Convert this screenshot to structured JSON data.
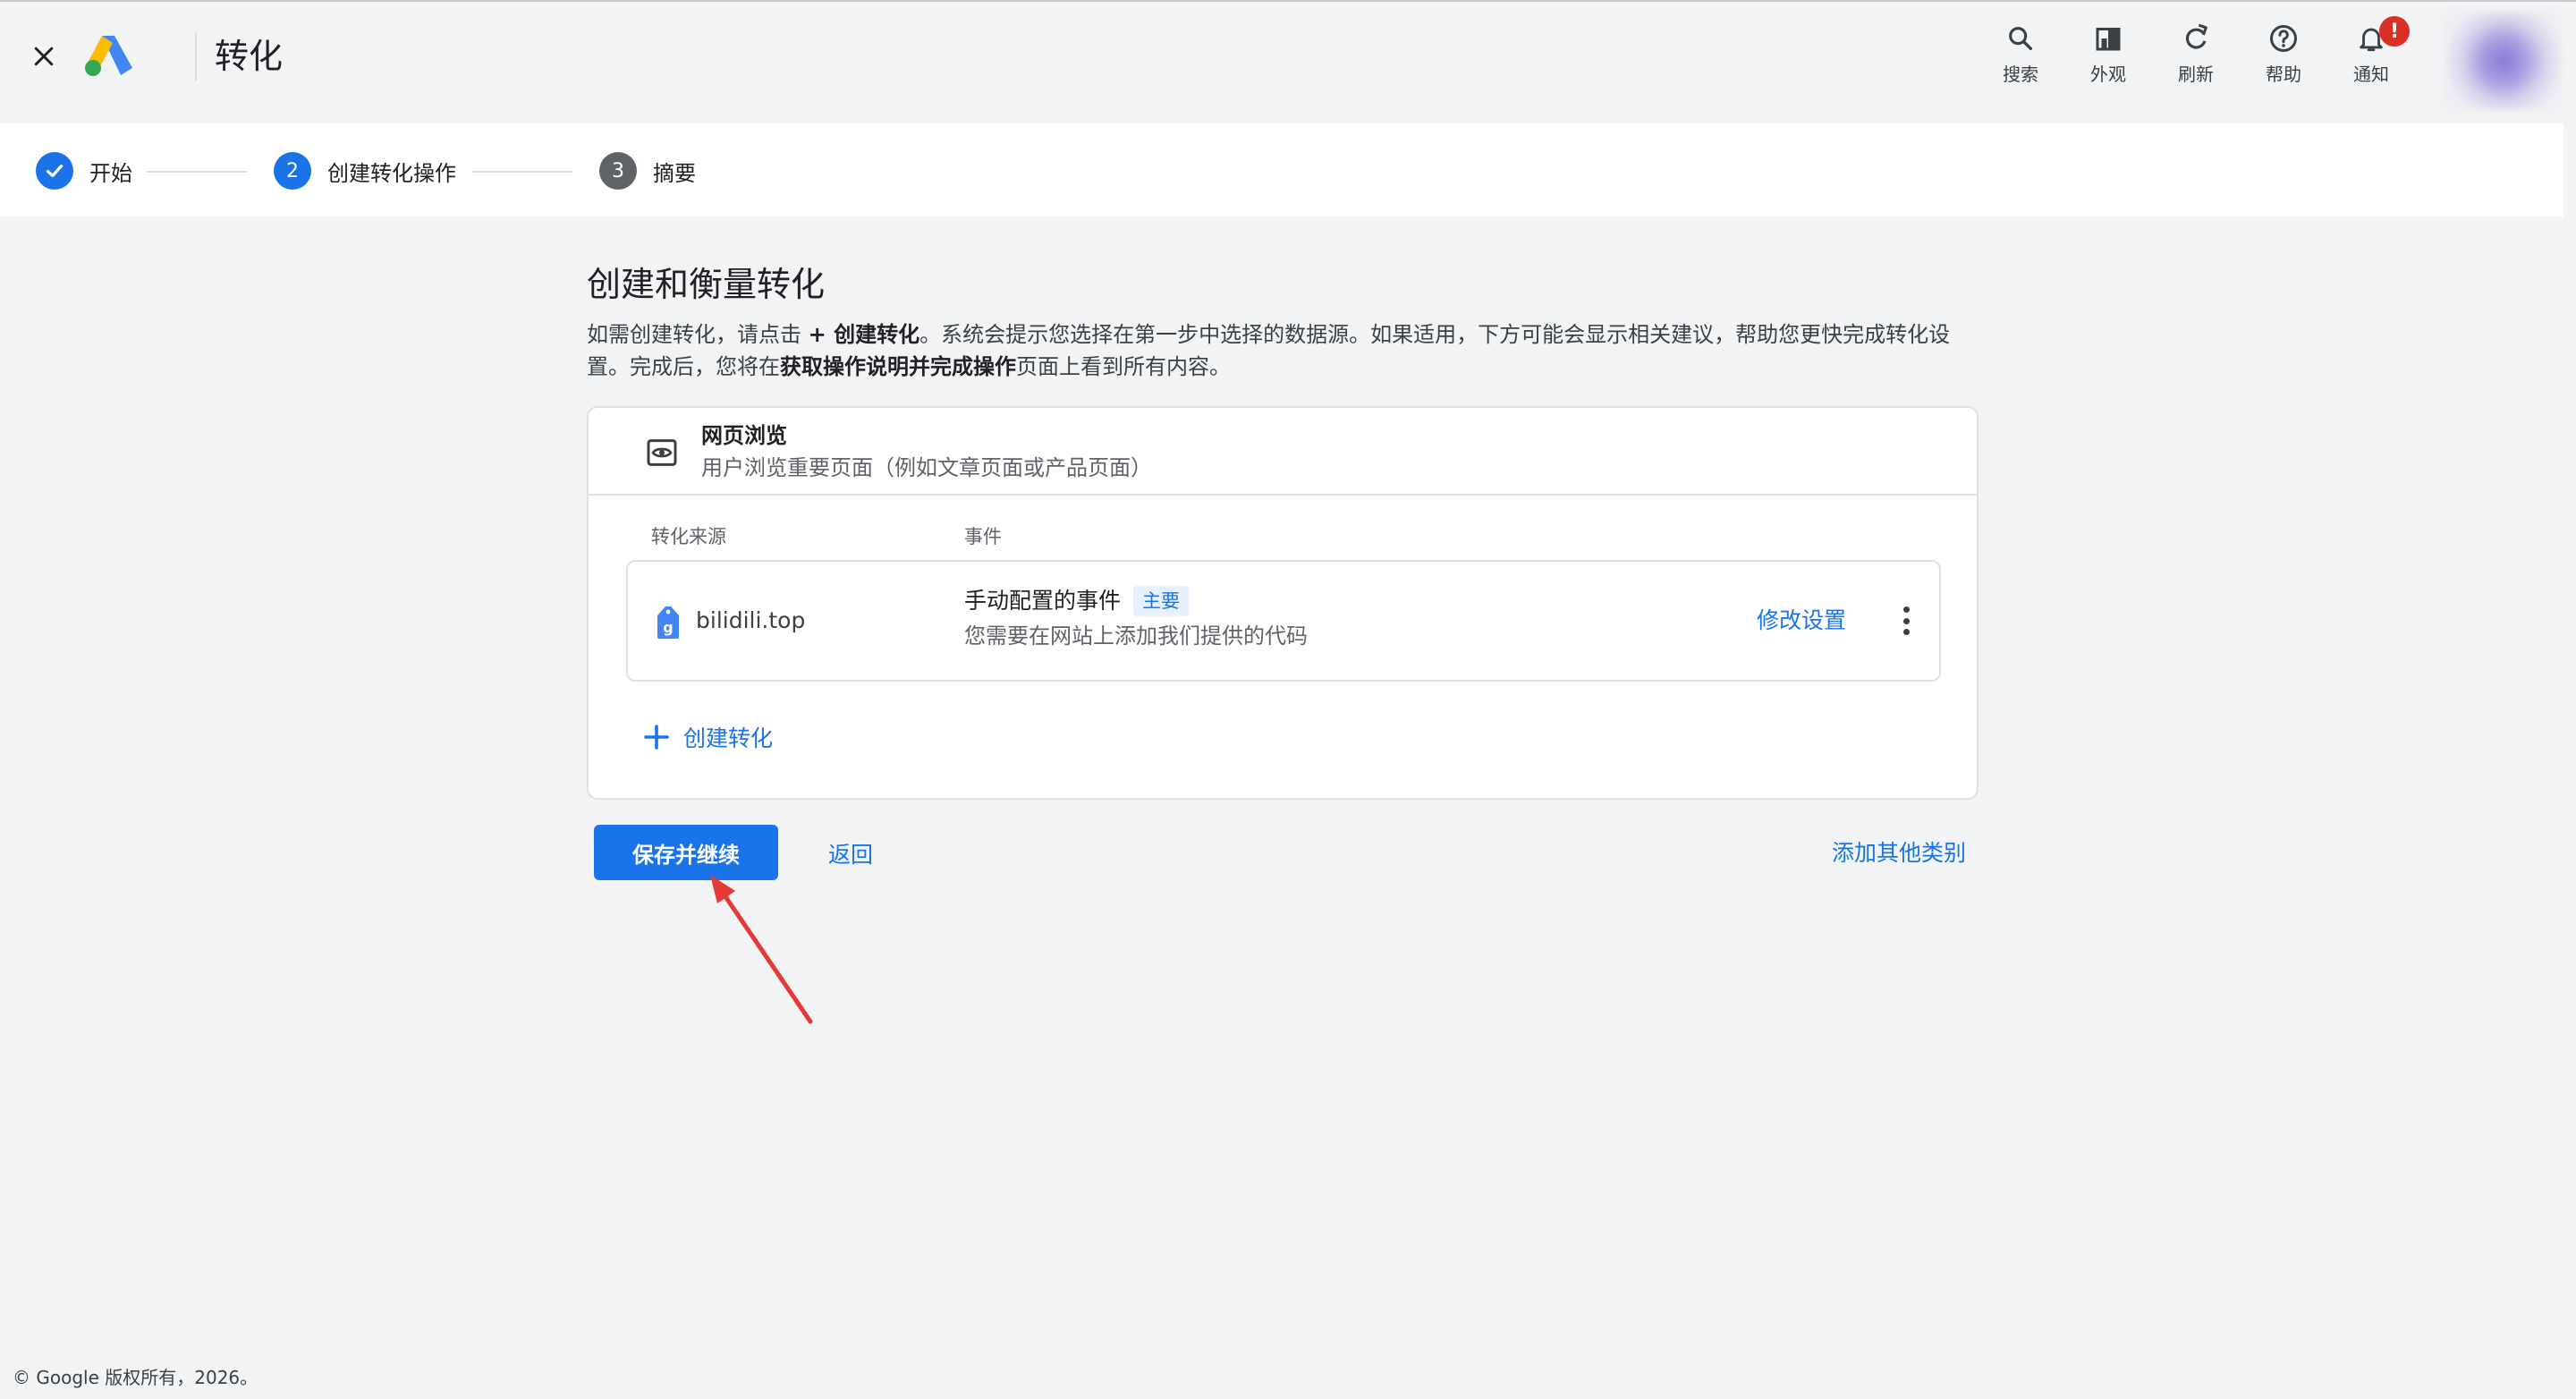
{
  "header": {
    "title": "转化",
    "actions": [
      {
        "icon": "search-icon",
        "label": "搜索"
      },
      {
        "icon": "appearance-icon",
        "label": "外观"
      },
      {
        "icon": "refresh-icon",
        "label": "刷新"
      },
      {
        "icon": "help-icon",
        "label": "帮助"
      },
      {
        "icon": "bell-icon",
        "label": "通知",
        "badge": "!"
      }
    ]
  },
  "stepper": {
    "steps": [
      {
        "index": "✓",
        "label": "开始",
        "state": "done"
      },
      {
        "index": "2",
        "label": "创建转化操作",
        "state": "current"
      },
      {
        "index": "3",
        "label": "摘要",
        "state": "pending"
      }
    ]
  },
  "main": {
    "heading": "创建和衡量转化",
    "desc_part1": "如需创建转化，请点击 ",
    "desc_bold1": "+ 创建转化",
    "desc_part2": "。系统会提示您选择在第一步中选择的数据源。如果适用，下方可能会显示相关建议，帮助您更快完成转化设置。完成后，您将在",
    "desc_bold2": "获取操作说明并完成操作",
    "desc_part3": "页面上看到所有内容。",
    "card": {
      "title": "网页浏览",
      "subtitle": "用户浏览重要页面（例如文章页面或产品页面）",
      "col_source": "转化来源",
      "col_event": "事件",
      "row": {
        "domain": "bilidili.top",
        "event": "手动配置的事件",
        "badge": "主要",
        "event_sub": "您需要在网站上添加我们提供的代码",
        "edit": "修改设置"
      },
      "create_label": "创建转化"
    },
    "buttons": {
      "save_continue": "保存并继续",
      "back": "返回",
      "add_category": "添加其他类别"
    }
  },
  "footer": {
    "copyright": "© Google 版权所有，2026。"
  },
  "colors": {
    "accent": "#1a73e8",
    "badge_red": "#d93025",
    "annotation_arrow": "#e53935"
  }
}
